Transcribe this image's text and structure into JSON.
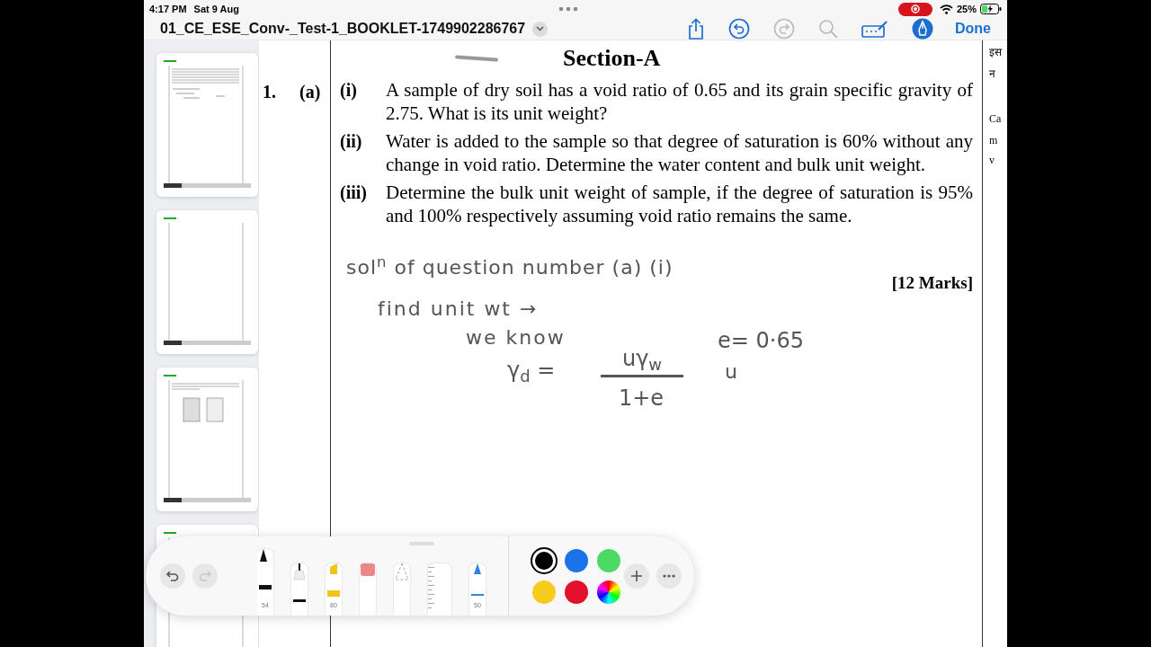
{
  "status_bar": {
    "time": "4:17 PM",
    "date": "Sat 9 Aug",
    "screen_recording": true,
    "battery": "25%"
  },
  "nav_bar": {
    "title": "01_CE_ESE_Conv-_Test-1_BOOKLET-1749902286767",
    "actions": [
      {
        "kind": "share",
        "disabled": false
      },
      {
        "kind": "undo",
        "disabled": false
      },
      {
        "kind": "redo",
        "disabled": true
      },
      {
        "kind": "search",
        "disabled": true
      },
      {
        "kind": "markup",
        "disabled": false
      },
      {
        "kind": "pen",
        "disabled": false
      }
    ],
    "markup_on": true,
    "done": "Done"
  },
  "thumbnails": [
    {
      "kind": "text"
    },
    {
      "kind": "blank"
    },
    {
      "kind": "figure"
    },
    {
      "kind": "text"
    }
  ],
  "document": {
    "section_title": "Section-A",
    "question_number": "1.",
    "part": "(a)",
    "questions": [
      {
        "label": "(i)",
        "text": "A sample of dry soil has a void ratio of 0.65 and its grain specific gravity of 2.75. What is its unit weight?"
      },
      {
        "label": "(ii)",
        "text": "Water is added to the sample so that degree of saturation is 60% without any change in void ratio. Determine the water content and bulk unit weight."
      },
      {
        "label": "(iii)",
        "text": "Determine the bulk unit weight of sample, if the degree of saturation is 95% and 100% respectively assuming void ratio remains the same."
      }
    ],
    "marks": "[12 Marks]",
    "margin_text": [
      "इस",
      "न",
      "Ca",
      "m",
      "v"
    ],
    "handwriting": {
      "heading": "sol$^{n}$ of question number (a) (i)",
      "line_2": "find unit wt →",
      "line_3": "we know",
      "lhs": "γ$_{d}$ =",
      "numerator": "uγ$_{w}$",
      "denominator": "1+e",
      "given": "e= 0·65",
      "given_2": "u"
    }
  },
  "markup_toolbar": {
    "undo_disabled": false,
    "redo_disabled": true,
    "tools": [
      {
        "kind": "pen",
        "label": "54",
        "selected": true
      },
      {
        "kind": "fineliner",
        "selected": false
      },
      {
        "kind": "marker",
        "label": "80",
        "selected": false
      },
      {
        "kind": "eraser",
        "selected": false
      },
      {
        "kind": "lasso",
        "selected": false
      },
      {
        "kind": "ruler",
        "selected": false
      },
      {
        "kind": "pencil",
        "label": "50",
        "selected": false
      }
    ],
    "colors": [
      {
        "kind": "swatch",
        "color": "#000000",
        "selected": true
      },
      {
        "kind": "swatch",
        "color": "#1a73e8",
        "selected": false
      },
      {
        "kind": "swatch",
        "color": "#4cd964",
        "selected": false
      },
      {
        "kind": "swatch",
        "color": "#f7cc1e",
        "selected": false
      },
      {
        "kind": "swatch",
        "color": "#e3102b",
        "selected": false
      },
      {
        "kind": "wheel",
        "selected": false
      }
    ]
  }
}
